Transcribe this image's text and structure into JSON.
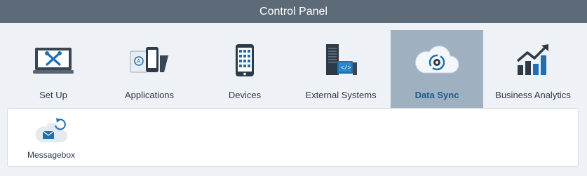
{
  "window": {
    "title": "Control Panel"
  },
  "tabs": [
    {
      "label": "Set Up",
      "icon": "tools-icon"
    },
    {
      "label": "Applications",
      "icon": "applications-icon"
    },
    {
      "label": "Devices",
      "icon": "mobile-device-icon"
    },
    {
      "label": "External Systems",
      "icon": "server-icon"
    },
    {
      "label": "Data Sync",
      "icon": "cloud-sync-icon",
      "active": true
    },
    {
      "label": "Business Analytics",
      "icon": "analytics-chart-icon"
    }
  ],
  "subpanel": {
    "items": [
      {
        "label": "Messagebox",
        "icon": "messagebox-cloud-icon"
      }
    ]
  },
  "colors": {
    "titlebar": "#5d6b79",
    "active_tab": "#9fb0c0",
    "active_label": "#1c5a90",
    "icon_blue": "#1f6fb2",
    "icon_dark": "#2d3a48"
  }
}
